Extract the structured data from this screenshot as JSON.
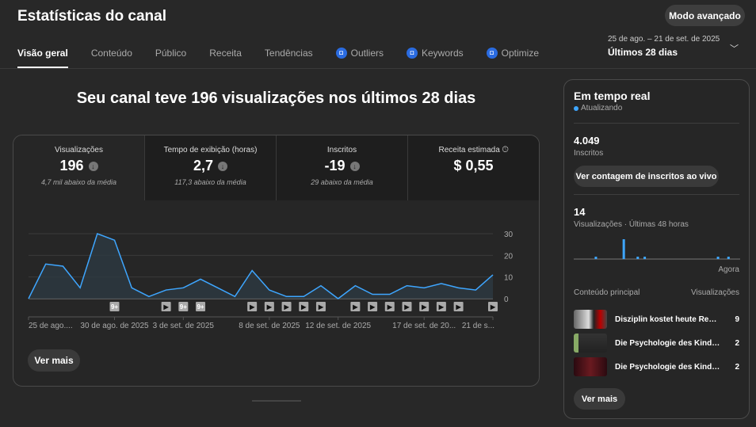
{
  "header": {
    "title": "Estatísticas do canal",
    "advanced_button": "Modo avançado"
  },
  "tabs": [
    {
      "label": "Visão geral",
      "active": true
    },
    {
      "label": "Conteúdo"
    },
    {
      "label": "Público"
    },
    {
      "label": "Receita"
    },
    {
      "label": "Tendências"
    },
    {
      "label": "Outliers",
      "extension": true
    },
    {
      "label": "Keywords",
      "extension": true
    },
    {
      "label": "Optimize",
      "extension": true
    }
  ],
  "date_range": {
    "dates": "25 de ago. – 21 de set. de 2025",
    "label": "Últimos 28 dias"
  },
  "headline": "Seu canal teve 196 visualizações nos últimos 28 dias",
  "metrics": [
    {
      "label": "Visualizações",
      "value": "196",
      "sub": "4,7 mil abaixo da média",
      "down": true
    },
    {
      "label": "Tempo de exibição (horas)",
      "value": "2,7",
      "sub": "117,3 abaixo da média",
      "down": true
    },
    {
      "label": "Inscritos",
      "value": "-19",
      "sub": "29 abaixo da média",
      "down": true
    },
    {
      "label": "Receita estimada",
      "value": "$ 0,55",
      "sub": "",
      "clock": true
    }
  ],
  "chart_data": {
    "type": "area",
    "title": "Visualizações",
    "ylim": [
      0,
      30
    ],
    "yticks": [
      0,
      10,
      20,
      30
    ],
    "values": [
      0,
      16,
      15,
      5,
      30,
      27,
      5,
      1,
      4,
      5,
      9,
      5,
      1,
      13,
      4,
      1,
      1,
      6,
      0,
      6,
      2,
      2,
      6,
      5,
      7,
      5,
      4,
      11
    ],
    "xticks": [
      {
        "i": 0,
        "label": "25 de ago...."
      },
      {
        "i": 5,
        "label": "30 de ago. de 2025"
      },
      {
        "i": 9,
        "label": "3 de set. de 2025"
      },
      {
        "i": 14,
        "label": "8 de set. de 2025"
      },
      {
        "i": 18,
        "label": "12 de set. de 2025"
      },
      {
        "i": 23,
        "label": "17 de set. de 20..."
      },
      {
        "i": 27,
        "label": "21 de s..."
      }
    ],
    "markers": [
      {
        "i": 5,
        "label": "9+"
      },
      {
        "i": 8,
        "label": "▶"
      },
      {
        "i": 9,
        "label": "9+"
      },
      {
        "i": 10,
        "label": "9+"
      },
      {
        "i": 13,
        "label": "▶"
      },
      {
        "i": 14,
        "label": "▶"
      },
      {
        "i": 15,
        "label": "▶"
      },
      {
        "i": 16,
        "label": "▶"
      },
      {
        "i": 17,
        "label": "▶"
      },
      {
        "i": 19,
        "label": "▶"
      },
      {
        "i": 20,
        "label": "▶"
      },
      {
        "i": 21,
        "label": "▶"
      },
      {
        "i": 22,
        "label": "▶"
      },
      {
        "i": 23,
        "label": "▶"
      },
      {
        "i": 24,
        "label": "▶"
      },
      {
        "i": 25,
        "label": "▶"
      },
      {
        "i": 27,
        "label": "▶"
      }
    ],
    "color": "#3ea6ff"
  },
  "card": {
    "more_button": "Ver mais"
  },
  "realtime": {
    "title": "Em tempo real",
    "status": "Atualizando",
    "subscribers": "4.049",
    "subscribers_label": "Inscritos",
    "live_button": "Ver contagem de inscritos ao vivo",
    "views": "14",
    "views_label": "Visualizações · Últimas 48 horas",
    "now_label": "Agora",
    "hourly": [
      0,
      0,
      0,
      0,
      0,
      0,
      1,
      0,
      0,
      0,
      0,
      0,
      0,
      0,
      9,
      0,
      0,
      0,
      1,
      0,
      1,
      0,
      0,
      0,
      0,
      0,
      0,
      0,
      0,
      0,
      0,
      0,
      0,
      0,
      0,
      0,
      0,
      0,
      0,
      0,
      0,
      1,
      0,
      0,
      1,
      0,
      0,
      0
    ],
    "col_content": "Conteúdo principal",
    "col_views": "Visualizações",
    "items": [
      {
        "title": "Disziplin kostet heute Reue k...",
        "views": "9"
      },
      {
        "title": "Die Psychologie des Kindes, ...",
        "views": "2"
      },
      {
        "title": "Die Psychologie des Kindes, ...",
        "views": "2"
      }
    ],
    "more_button": "Ver mais"
  }
}
